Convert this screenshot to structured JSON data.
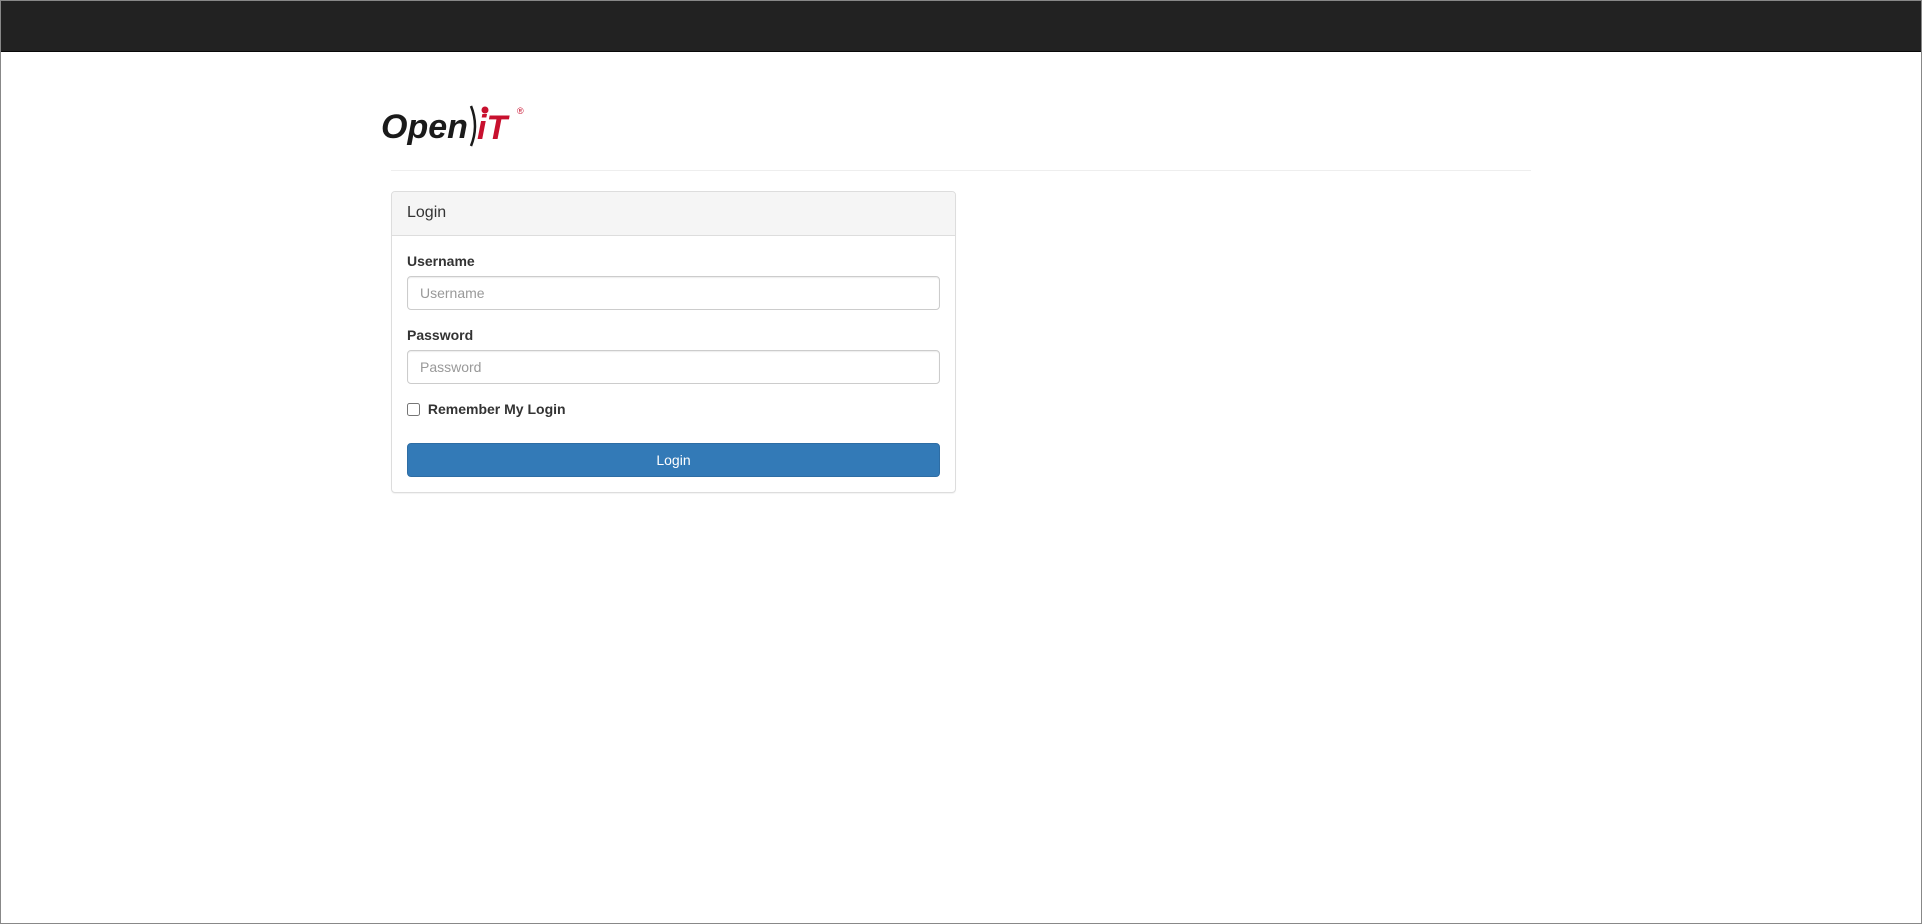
{
  "logo": {
    "brand_text_open": "Open",
    "brand_text_it": "iT",
    "brand_color_dark": "#1a1a1a",
    "brand_color_red": "#c8102e"
  },
  "panel": {
    "heading": "Login"
  },
  "form": {
    "username_label": "Username",
    "username_placeholder": "Username",
    "password_label": "Password",
    "password_placeholder": "Password",
    "remember_label": "Remember My Login",
    "login_button": "Login"
  }
}
